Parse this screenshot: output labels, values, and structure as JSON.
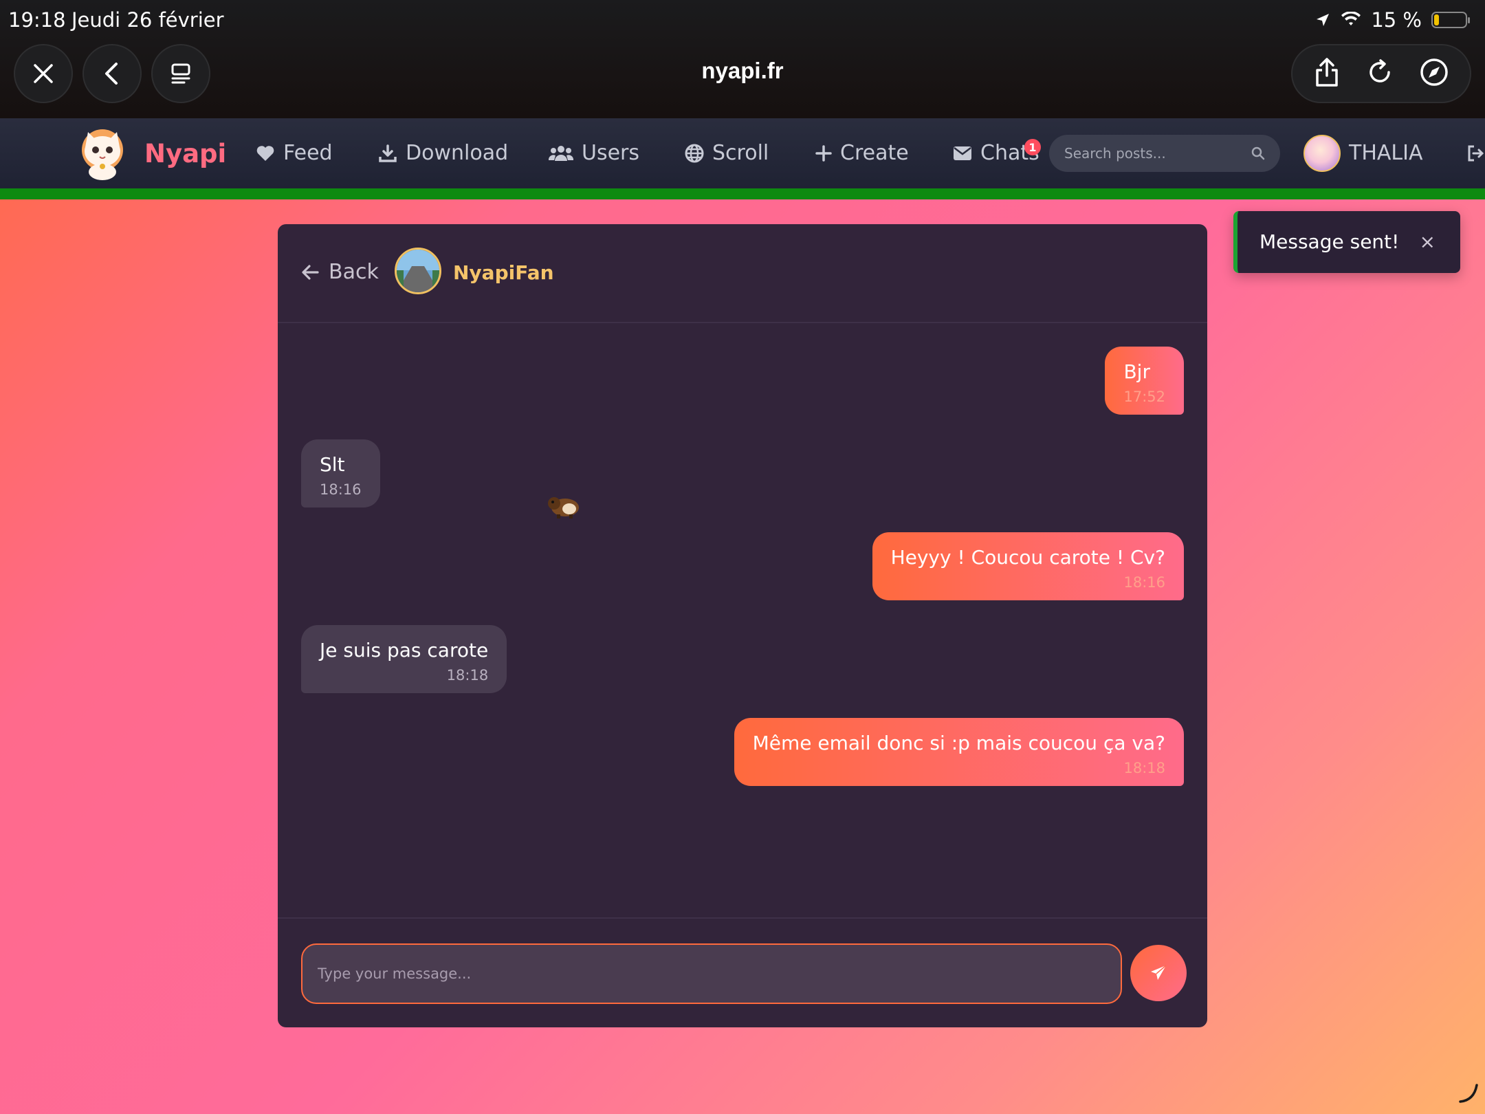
{
  "status_bar": {
    "time": "19:18",
    "date": "Jeudi 26 février",
    "battery": "15 %"
  },
  "browser": {
    "url": "nyapi.fr",
    "icons": [
      "close-icon",
      "back-icon",
      "tabs-icon",
      "share-icon",
      "reload-icon",
      "compass-icon"
    ]
  },
  "nav": {
    "brand": "Nyapi",
    "items": [
      {
        "label": "Feed",
        "icon": "heart-icon"
      },
      {
        "label": "Download",
        "icon": "download-icon"
      },
      {
        "label": "Users",
        "icon": "users-icon"
      },
      {
        "label": "Scroll",
        "icon": "globe-icon"
      },
      {
        "label": "Create",
        "icon": "plus-icon"
      },
      {
        "label": "Chats",
        "icon": "envelope-icon",
        "badge": "1"
      }
    ],
    "search_placeholder": "Search posts...",
    "user_name": "THALIA",
    "accent": "#0e8a10"
  },
  "chat": {
    "back_label": "Back",
    "contact_name": "NyapiFan",
    "messages": [
      {
        "direction": "sent",
        "text": "Bjr",
        "time": "17:52"
      },
      {
        "direction": "received",
        "text": "Slt",
        "time": "18:16"
      },
      {
        "direction": "sent",
        "text": "Heyyy ! Coucou carote ! Cv?",
        "time": "18:16"
      },
      {
        "direction": "received",
        "text": "Je suis pas carote",
        "time": "18:18"
      },
      {
        "direction": "sent",
        "text": "Même email donc si :p mais coucou ça va?",
        "time": "18:18"
      }
    ],
    "input_placeholder": "Type your message...",
    "colors": {
      "sent": "#ff6a3d",
      "received": "#483c50",
      "panel": "#32243a"
    }
  },
  "toast": {
    "text": "Message sent!",
    "close": "×"
  }
}
